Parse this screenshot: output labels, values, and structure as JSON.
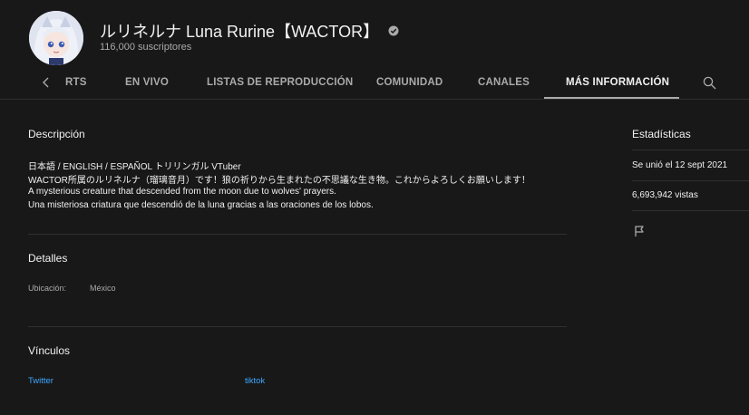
{
  "channel": {
    "name": "ルリネルナ Luna Rurine【WACTOR】",
    "subscribers": "116,000 suscriptores"
  },
  "tabs": [
    {
      "label": "RTS"
    },
    {
      "label": "EN VIVO"
    },
    {
      "label": "LISTAS DE REPRODUCCIÓN"
    },
    {
      "label": "COMUNIDAD"
    },
    {
      "label": "CANALES"
    },
    {
      "label": "MÁS INFORMACIÓN",
      "active": true
    }
  ],
  "description": {
    "title": "Descripción",
    "lines": [
      "日本語 / ENGLISH / ESPAÑOL トリリンガル VTuber",
      "WACTOR所属のルリネルナ（瑠璃音月）です！狼の祈りから生まれたの不思議な生き物。これからよろしくお願いします！",
      "A mysterious creature that descended from the moon due to wolves' prayers.",
      "Una misteriosa criatura que descendió de la luna gracias a las oraciones de los lobos."
    ]
  },
  "details": {
    "title": "Detalles",
    "location_label": "Ubicación:",
    "location_value": "México"
  },
  "links": {
    "title": "Vínculos",
    "items": [
      "Twitter",
      "tiktok"
    ]
  },
  "stats": {
    "title": "Estadísticas",
    "joined": "Se unió el 12 sept 2021",
    "views": "6,693,942 vistas"
  },
  "colors": {
    "background": "#181818",
    "link": "#3ea6ff",
    "secondary_text": "#aaaaaa"
  }
}
